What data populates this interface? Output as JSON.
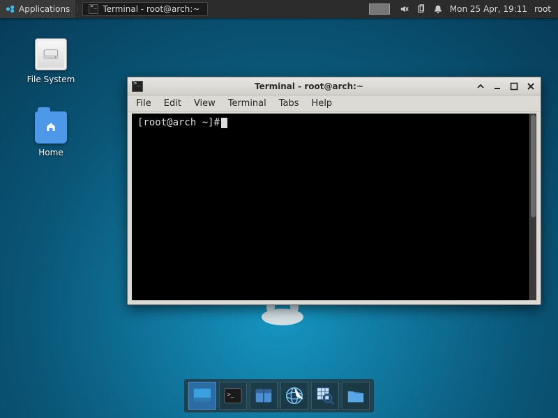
{
  "panel": {
    "applications_label": "Applications",
    "task_title": "Terminal - root@arch:~",
    "datetime": "Mon 25 Apr, 19:11",
    "user": "root"
  },
  "desktop": {
    "file_system_label": "File System",
    "home_label": "Home"
  },
  "window": {
    "title": "Terminal - root@arch:~",
    "menu": {
      "file": "File",
      "edit": "Edit",
      "view": "View",
      "terminal": "Terminal",
      "tabs": "Tabs",
      "help": "Help"
    },
    "prompt": "[root@arch ~]#"
  },
  "dock": {
    "items": [
      "show-desktop",
      "terminal",
      "file-manager",
      "web-browser",
      "magnifier",
      "folder"
    ]
  }
}
